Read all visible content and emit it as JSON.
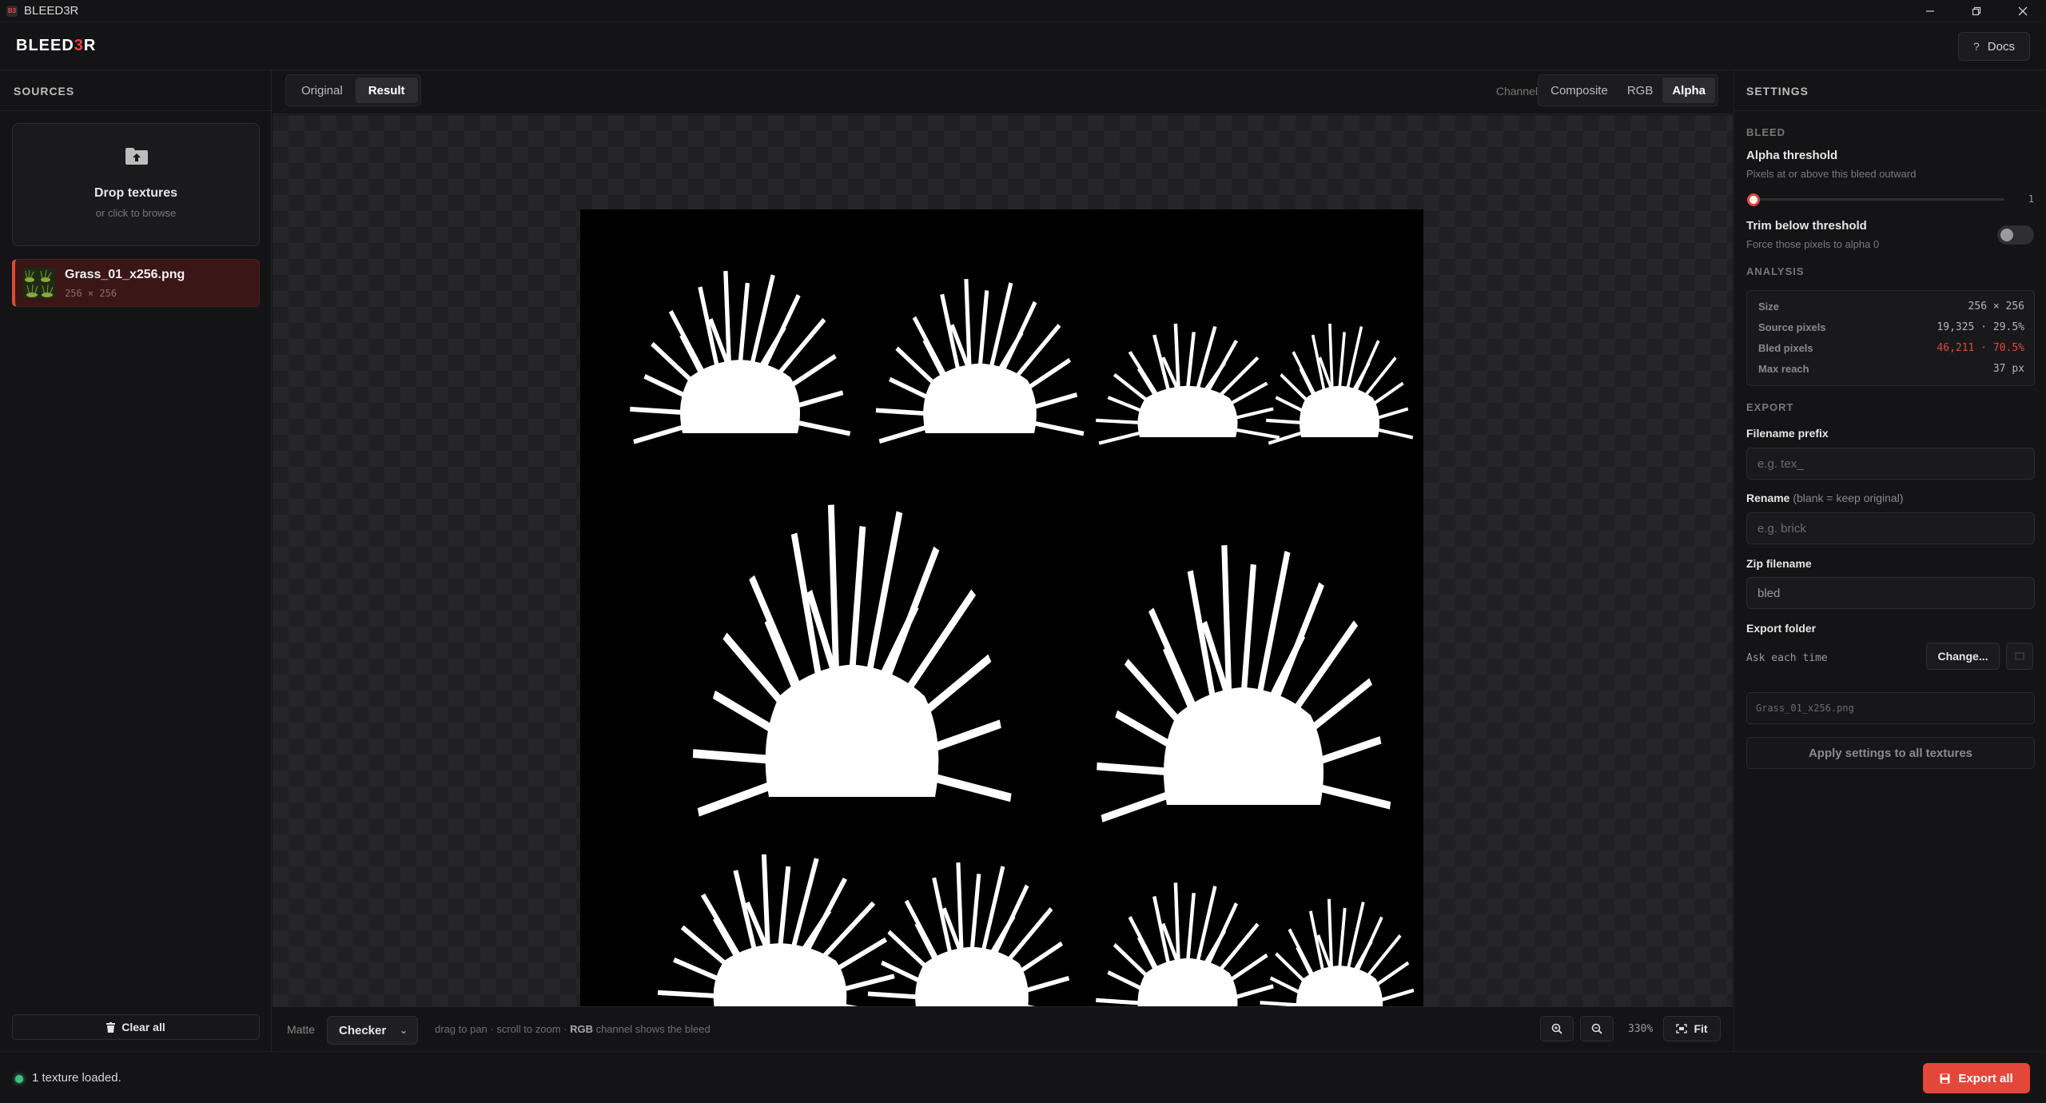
{
  "window": {
    "title": "BLEED3R",
    "app_icon_label": "B3"
  },
  "header": {
    "logo_prefix": "BLEED",
    "logo_accent": "3",
    "logo_suffix": "R",
    "docs_label": "Docs"
  },
  "sources": {
    "title": "SOURCES",
    "dropzone": {
      "title": "Drop textures",
      "subtitle": "or click to browse"
    },
    "files": [
      {
        "name": "Grass_01_x256.png",
        "dims": "256 × 256"
      }
    ],
    "clear_label": "Clear all"
  },
  "viewer": {
    "view_tabs": [
      "Original",
      "Result"
    ],
    "active_view": "Result",
    "channel_label": "Channel",
    "channel_tabs": [
      "Composite",
      "RGB",
      "Alpha"
    ],
    "active_channel": "Alpha",
    "matte_label": "Matte",
    "matte_value": "Checker",
    "hint_pre": "drag to pan · scroll to zoom · ",
    "hint_bold": "RGB",
    "hint_post": " channel shows the bleed",
    "zoom": "330%",
    "fit_label": "Fit"
  },
  "settings": {
    "title": "SETTINGS",
    "bleed": {
      "section": "BLEED",
      "alpha_threshold_title": "Alpha threshold",
      "alpha_threshold_desc": "Pixels at or above this bleed outward",
      "alpha_threshold_value": "1",
      "trim_title": "Trim below threshold",
      "trim_desc": "Force those pixels to alpha 0",
      "trim_enabled": false
    },
    "analysis": {
      "section": "ANALYSIS",
      "rows": [
        {
          "key": "Size",
          "value": "256 × 256"
        },
        {
          "key": "Source pixels",
          "value": "19,325 · 29.5%"
        },
        {
          "key": "Bled pixels",
          "value": "46,211 · 70.5%"
        },
        {
          "key": "Max reach",
          "value": "37 px"
        }
      ]
    },
    "export": {
      "section": "EXPORT",
      "prefix_label": "Filename prefix",
      "prefix_placeholder": "e.g. tex_",
      "rename_label": "Rename",
      "rename_hint": "(blank = keep original)",
      "rename_placeholder": "e.g. brick",
      "zip_label": "Zip filename",
      "zip_value": "bled",
      "folder_label": "Export folder",
      "folder_value": "Ask each time",
      "change_label": "Change...",
      "filename_preview": "Grass_01_x256.png",
      "apply_label": "Apply settings to all textures"
    }
  },
  "status": {
    "text": "1 texture loaded.",
    "export_label": "Export all"
  },
  "colors": {
    "accent": "#e5463a",
    "status_ok": "#3ec07a",
    "background": "#121214"
  }
}
